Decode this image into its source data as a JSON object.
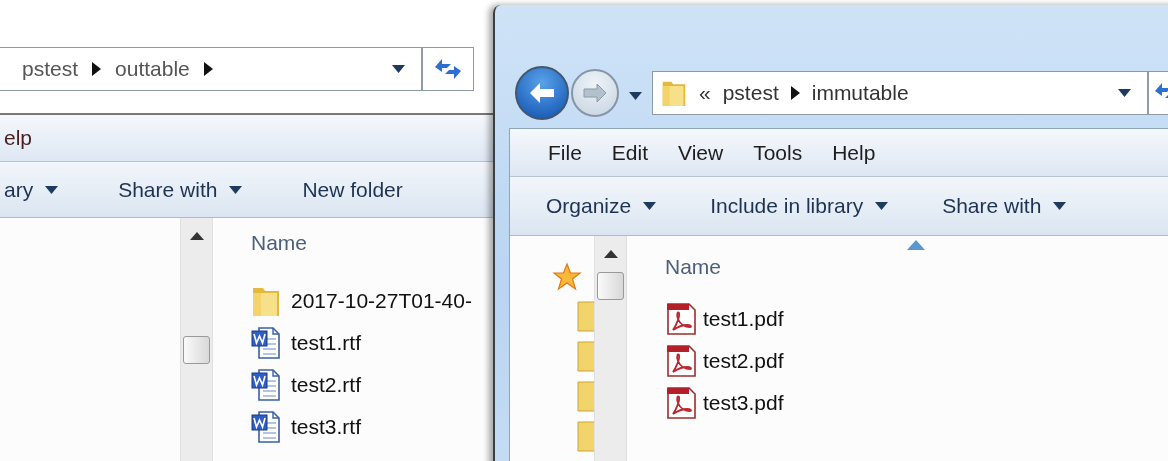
{
  "windows": [
    {
      "address": {
        "crumbs": [
          "pstest",
          "outtable"
        ],
        "trailing_arrow": true
      },
      "menu": [
        "elp"
      ],
      "commands": [
        {
          "label": "ary",
          "dropdown": true
        },
        {
          "label": "Share with",
          "dropdown": true
        },
        {
          "label": "New folder",
          "dropdown": false
        }
      ],
      "column": {
        "label": "Name",
        "sorted": false
      },
      "files": [
        {
          "name": "2017-10-27T01-40-",
          "kind": "folder"
        },
        {
          "name": "test1.rtf",
          "kind": "rtf"
        },
        {
          "name": "test2.rtf",
          "kind": "rtf"
        },
        {
          "name": "test3.rtf",
          "kind": "rtf"
        }
      ]
    },
    {
      "address": {
        "prefix": "«",
        "crumbs": [
          "pstest",
          "immutable"
        ],
        "trailing_arrow": false
      },
      "nav_buttons": {
        "forward_disabled": true
      },
      "menu": [
        "File",
        "Edit",
        "View",
        "Tools",
        "Help"
      ],
      "commands": [
        {
          "label": "Organize",
          "dropdown": true
        },
        {
          "label": "Include in library",
          "dropdown": true
        },
        {
          "label": "Share with",
          "dropdown": true
        }
      ],
      "column": {
        "label": "Name",
        "sorted": true
      },
      "nav_pane": [
        {
          "kind": "star"
        },
        {
          "kind": "folder"
        },
        {
          "kind": "folder"
        },
        {
          "kind": "folder"
        },
        {
          "kind": "folder"
        }
      ],
      "files": [
        {
          "name": "test1.pdf",
          "kind": "pdf"
        },
        {
          "name": "test2.pdf",
          "kind": "pdf"
        },
        {
          "name": "test3.pdf",
          "kind": "pdf"
        }
      ]
    }
  ]
}
